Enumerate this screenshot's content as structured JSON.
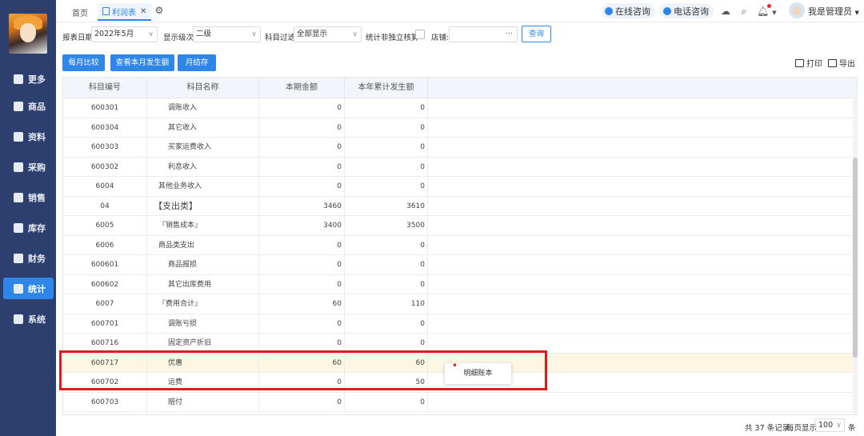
{
  "sidebar": {
    "items": [
      {
        "label": "更多",
        "icon": "plus-square-icon",
        "active": false
      },
      {
        "label": "商品",
        "icon": "bag-icon",
        "active": false
      },
      {
        "label": "资料",
        "icon": "profile-card-icon",
        "active": false
      },
      {
        "label": "采购",
        "icon": "purchase-icon",
        "active": false
      },
      {
        "label": "销售",
        "icon": "bar-chart-icon",
        "active": false
      },
      {
        "label": "库存",
        "icon": "warehouse-icon",
        "active": false
      },
      {
        "label": "财务",
        "icon": "finance-icon",
        "active": false
      },
      {
        "label": "统计",
        "icon": "statistics-icon",
        "active": true
      },
      {
        "label": "系统",
        "icon": "gear-icon",
        "active": false
      }
    ]
  },
  "topbar": {
    "home_tab": "首页",
    "active_tab": "利润表",
    "online_consult": "在线咨询",
    "phone_consult": "电话咨询",
    "user_name": "我是管理员"
  },
  "filters": {
    "date_label": "报表日期",
    "date_value": "2022年5月",
    "level_label": "显示级次",
    "level_value": "二级",
    "subject_filter_label": "科目过滤",
    "subject_filter_value": "全部显示",
    "non_independent_label": "统计非独立核算",
    "store_label": "店铺:",
    "store_dots": "···",
    "query_button": "查询"
  },
  "actions": {
    "monthly_compare": "每月比较",
    "view_month_amount": "查看本月发生额",
    "month_close": "月结存",
    "print": "打印",
    "export": "导出"
  },
  "table": {
    "headers": [
      "科目编号",
      "科目名称",
      "本期金额",
      "本年累计发生额"
    ],
    "rows": [
      {
        "code": "600301",
        "name": "调账收入",
        "current": "0",
        "ytd": "0",
        "indent": 2
      },
      {
        "code": "600304",
        "name": "其它收入",
        "current": "0",
        "ytd": "0",
        "indent": 2
      },
      {
        "code": "600303",
        "name": "买家运费收入",
        "current": "0",
        "ytd": "0",
        "indent": 2
      },
      {
        "code": "600302",
        "name": "利息收入",
        "current": "0",
        "ytd": "0",
        "indent": 2
      },
      {
        "code": "6004",
        "name": "其他业务收入",
        "current": "0",
        "ytd": "0",
        "indent": 1
      },
      {
        "code": "04",
        "name": "【支出类】",
        "current": "3460",
        "ytd": "3610",
        "indent": 0
      },
      {
        "code": "6005",
        "name": "『销售成本』",
        "current": "3400",
        "ytd": "3500",
        "indent": 1
      },
      {
        "code": "6006",
        "name": "商品类支出",
        "current": "0",
        "ytd": "0",
        "indent": 1
      },
      {
        "code": "600601",
        "name": "商品报损",
        "current": "0",
        "ytd": "0",
        "indent": 2
      },
      {
        "code": "600602",
        "name": "其它出库费用",
        "current": "0",
        "ytd": "0",
        "indent": 2
      },
      {
        "code": "6007",
        "name": "『费用合计』",
        "current": "60",
        "ytd": "110",
        "indent": 1
      },
      {
        "code": "600701",
        "name": "调账亏损",
        "current": "0",
        "ytd": "0",
        "indent": 2
      },
      {
        "code": "600716",
        "name": "固定资产折旧",
        "current": "0",
        "ytd": "0",
        "indent": 2
      },
      {
        "code": "600717",
        "name": "优惠",
        "current": "60",
        "ytd": "60",
        "indent": 2,
        "highlight": true
      },
      {
        "code": "600702",
        "name": "运费",
        "current": "0",
        "ytd": "50",
        "indent": 2
      },
      {
        "code": "600703",
        "name": "赔付",
        "current": "0",
        "ytd": "0",
        "indent": 2
      }
    ]
  },
  "context_menu": {
    "item": "明细账本"
  },
  "footer": {
    "total": "共 37 条记录",
    "per_page_label": "每页显示",
    "per_page_value": "100",
    "unit": "条"
  },
  "colors": {
    "sidebar": "#2d3f6e",
    "accent": "#2e86e8",
    "highlight_row": "#fdf6e3",
    "annotation_box": "#e01b1b"
  }
}
